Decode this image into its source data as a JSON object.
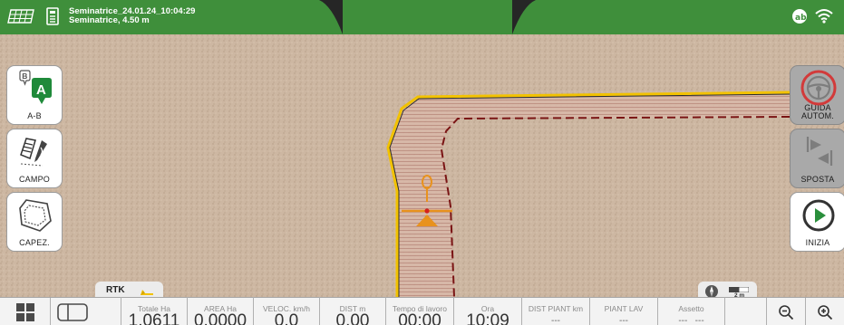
{
  "colors": {
    "accent_green": "#3f8f3b",
    "soil": "#c9b39e",
    "boundary_yellow": "#f2c200",
    "pass_line": "#7a1414",
    "vehicle": "#e8921e"
  },
  "header": {
    "task_title": "Seminatrice_24.01.24_10:04:29",
    "implement_subtitle": "Seminatrice, 4.50 m"
  },
  "left_buttons": [
    {
      "label": "A-B",
      "icon": "ab-line-icon"
    },
    {
      "label": "CAMPO",
      "icon": "field-draw-icon"
    },
    {
      "label": "CAPEZ.",
      "icon": "headland-icon"
    }
  ],
  "right_buttons": [
    {
      "label": "GUIDA\nAUTOM.",
      "icon": "steering-wheel-icon"
    },
    {
      "label": "SPOSTA",
      "icon": "shift-icon"
    },
    {
      "label": "INIZIA",
      "icon": "play-icon"
    }
  ],
  "status": {
    "rtk": "RTK",
    "scale": "2 m"
  },
  "metrics": [
    {
      "header": "Totale Ha",
      "value": "1.0611"
    },
    {
      "header": "AREA Ha",
      "value": "0.0000"
    },
    {
      "header": "VELOC. km/h",
      "value": "0.0"
    },
    {
      "header": "DIST m",
      "value": "0.00"
    },
    {
      "header": "Tempo di lavoro",
      "value": "00:00"
    },
    {
      "header": "Ora",
      "value": "10:09"
    },
    {
      "header": "DIST PIANT km",
      "value": "---"
    },
    {
      "header": "PIANT LAV",
      "value": "---"
    },
    {
      "header": "Assetto",
      "value": "---   ---"
    }
  ]
}
